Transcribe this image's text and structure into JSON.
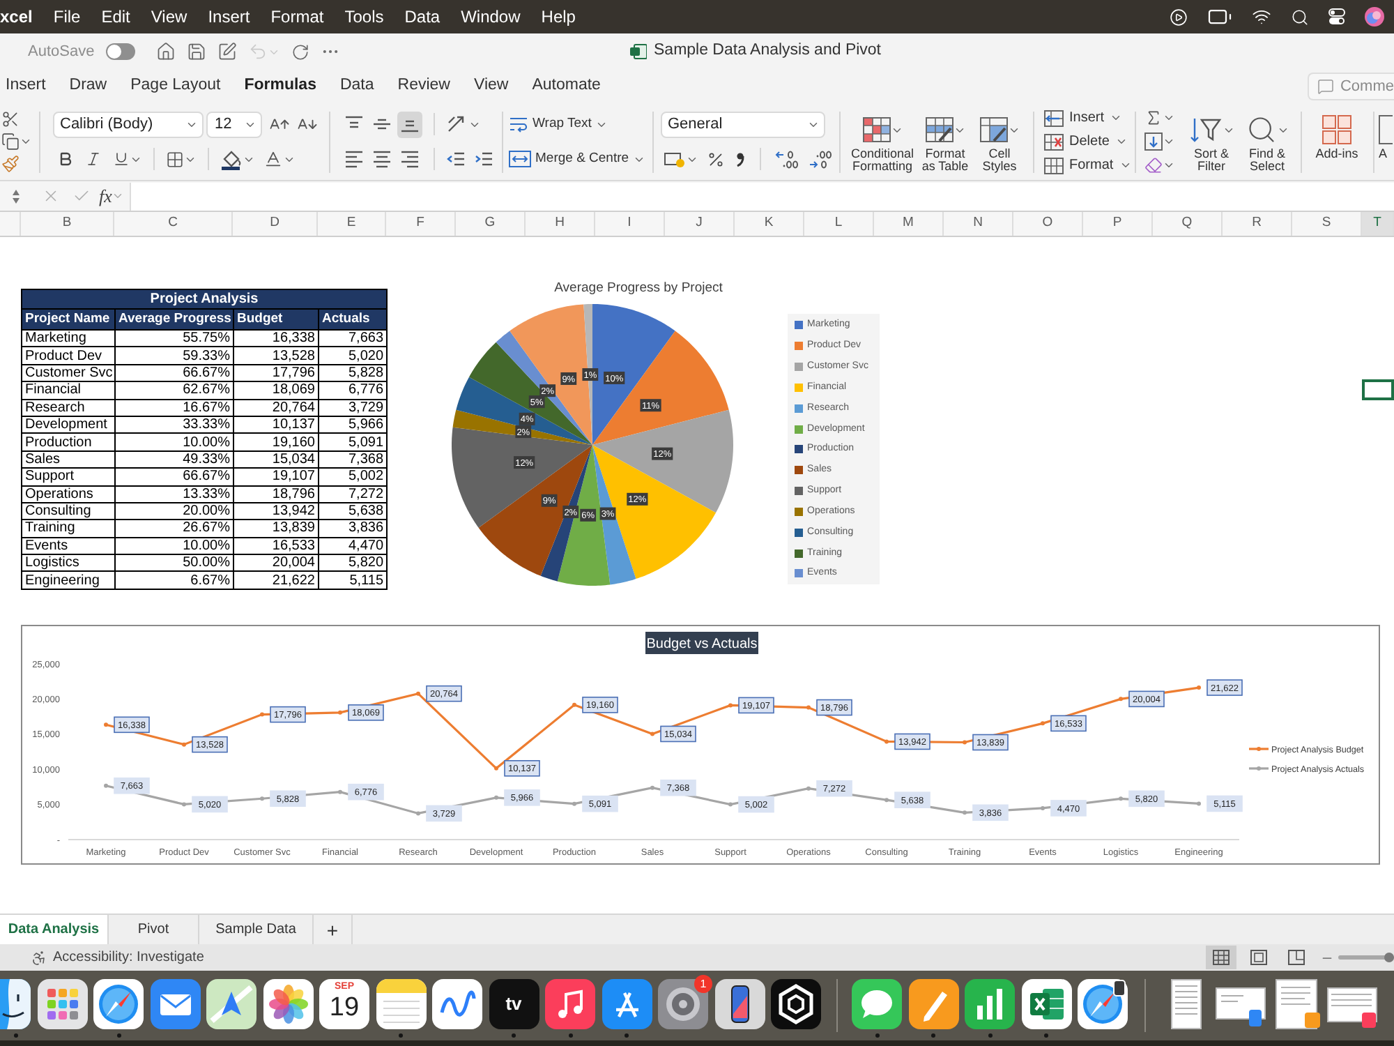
{
  "menu_bar": {
    "app": "xcel",
    "items": [
      "File",
      "Edit",
      "View",
      "Insert",
      "Format",
      "Tools",
      "Data",
      "Window",
      "Help"
    ]
  },
  "title_bar": {
    "autosave": {
      "label": "AutoSave",
      "on": false,
      "disabled": true
    },
    "undo": {
      "disabled": true
    },
    "title": "Sample Data Analysis and Pivot"
  },
  "ribbon": {
    "tabs": [
      {
        "label": "Insert",
        "selected": false
      },
      {
        "label": "Draw",
        "selected": false
      },
      {
        "label": "Page Layout",
        "selected": false
      },
      {
        "label": "Formulas",
        "selected": true
      },
      {
        "label": "Data",
        "selected": false
      },
      {
        "label": "Review",
        "selected": false
      },
      {
        "label": "View",
        "selected": false
      },
      {
        "label": "Automate",
        "selected": false
      }
    ],
    "comments": "Comme",
    "font_name": "Calibri (Body)",
    "font_size": "12",
    "vertical_alignment": [
      {
        "kind": "top",
        "selected": false
      },
      {
        "kind": "middle",
        "selected": false
      },
      {
        "kind": "bottom",
        "selected": true
      }
    ],
    "wrap_text": "Wrap Text",
    "merge": "Merge & Centre",
    "number_format": "General",
    "styles": [
      "Conditional\nFormatting",
      "Format\nas Table",
      "Cell\nStyles"
    ],
    "cells": [
      "Insert",
      "Delete",
      "Format"
    ],
    "sort_filter": "Sort &\nFilter",
    "find_select": "Find &\nSelect",
    "add_ins": "Add-ins",
    "cut_off_button": "A"
  },
  "formula_bar": {
    "function_label": "fx"
  },
  "columns": [
    {
      "label": "B",
      "selected": false
    },
    {
      "label": "C",
      "selected": false
    },
    {
      "label": "D",
      "selected": false
    },
    {
      "label": "E",
      "selected": false
    },
    {
      "label": "F",
      "selected": false
    },
    {
      "label": "G",
      "selected": false
    },
    {
      "label": "H",
      "selected": false
    },
    {
      "label": "I",
      "selected": false
    },
    {
      "label": "J",
      "selected": false
    },
    {
      "label": "K",
      "selected": false
    },
    {
      "label": "L",
      "selected": false
    },
    {
      "label": "M",
      "selected": false
    },
    {
      "label": "N",
      "selected": false
    },
    {
      "label": "O",
      "selected": false
    },
    {
      "label": "P",
      "selected": false
    },
    {
      "label": "Q",
      "selected": false
    },
    {
      "label": "R",
      "selected": false
    },
    {
      "label": "S",
      "selected": false
    },
    {
      "label": "T",
      "selected": true
    }
  ],
  "table": {
    "title": "Project Analysis",
    "columns": [
      "Project Name",
      "Average Progress",
      "Budget",
      "Actuals"
    ],
    "rows": [
      [
        "Marketing",
        "55.75%",
        "16,338",
        "7,663"
      ],
      [
        "Product Dev",
        "59.33%",
        "13,528",
        "5,020"
      ],
      [
        "Customer Svc",
        "66.67%",
        "17,796",
        "5,828"
      ],
      [
        "Financial",
        "62.67%",
        "18,069",
        "6,776"
      ],
      [
        "Research",
        "16.67%",
        "20,764",
        "3,729"
      ],
      [
        "Development",
        "33.33%",
        "10,137",
        "5,966"
      ],
      [
        "Production",
        "10.00%",
        "19,160",
        "5,091"
      ],
      [
        "Sales",
        "49.33%",
        "15,034",
        "7,368"
      ],
      [
        "Support",
        "66.67%",
        "19,107",
        "5,002"
      ],
      [
        "Operations",
        "13.33%",
        "18,796",
        "7,272"
      ],
      [
        "Consulting",
        "20.00%",
        "13,942",
        "5,638"
      ],
      [
        "Training",
        "26.67%",
        "13,839",
        "3,836"
      ],
      [
        "Events",
        "10.00%",
        "16,533",
        "4,470"
      ],
      [
        "Logistics",
        "50.00%",
        "20,004",
        "5,820"
      ],
      [
        "Engineering",
        "6.67%",
        "21,622",
        "5,115"
      ]
    ]
  },
  "pie_chart": {
    "chart_data": [
      {
        "type": "pie",
        "title": "Average Progress by Project",
        "categories": [
          "Marketing",
          "Product Dev",
          "Customer Svc",
          "Financial",
          "Research",
          "Development",
          "Production",
          "Sales",
          "Support",
          "Operations",
          "Consulting",
          "Training",
          "Events",
          null,
          null
        ],
        "values": [
          10,
          11,
          12,
          12,
          3,
          6,
          2,
          9,
          12,
          2,
          4,
          5,
          2,
          9,
          1
        ],
        "colors": [
          "#4472c4",
          "#ed7d31",
          "#a5a5a5",
          "#ffc000",
          "#5b9bd5",
          "#70ad47",
          "#264478",
          "#9e480e",
          "#636363",
          "#997300",
          "#255e91",
          "#43682b",
          "#698ed0",
          "#f1975a",
          "#b7b7b7"
        ],
        "data_labels": true,
        "value_labels": [
          "10%",
          "11%",
          "12%",
          "12%",
          "3%",
          "6%",
          "2%",
          "9%",
          "12%",
          "2%",
          "4%",
          "5%",
          "2%",
          "9%",
          "1%"
        ],
        "legend": "right"
      }
    ]
  },
  "line_chart": {
    "chart_data": [
      {
        "type": "line",
        "title": "Budget vs Actuals",
        "categories": [
          "Marketing",
          "Product Dev",
          "Customer Svc",
          "Financial",
          "Research",
          "Development",
          "Production",
          "Sales",
          "Support",
          "Operations",
          "Consulting",
          "Training",
          "Events",
          "Logistics",
          "Engineering"
        ],
        "series": [
          {
            "name": "Project Analysis Budget",
            "color": "#ed7d31",
            "values": [
              16338,
              13528,
              17796,
              18069,
              20764,
              10137,
              19160,
              15034,
              19107,
              18796,
              13942,
              13839,
              16533,
              20004,
              21622
            ],
            "value_labels": [
              "16,338",
              "13,528",
              "17,796",
              "18,069",
              "20,764",
              "10,137",
              "19,160",
              "15,034",
              "19,107",
              "18,796",
              "13,942",
              "13,839",
              "16,533",
              "20,004",
              "21,622"
            ]
          },
          {
            "name": "Project Analysis Actuals",
            "color": "#a5a5a5",
            "values": [
              7663,
              5020,
              5828,
              6776,
              3729,
              5966,
              5091,
              7368,
              5002,
              7272,
              5638,
              3836,
              4470,
              5820,
              5115
            ],
            "value_labels": [
              "7,663",
              "5,020",
              "5,828",
              "6,776",
              "3,729",
              "5,966",
              "5,091",
              "7,368",
              "5,002",
              "7,272",
              "5,638",
              "3,836",
              "4,470",
              "5,820",
              "5,115"
            ]
          }
        ],
        "ylim": [
          0,
          25000
        ],
        "yticks": [
          {
            "value": 0,
            "label": "-"
          },
          {
            "value": 5000,
            "label": "5,000"
          },
          {
            "value": 10000,
            "label": "10,000"
          },
          {
            "value": 15000,
            "label": "15,000"
          },
          {
            "value": 20000,
            "label": "20,000"
          },
          {
            "value": 25000,
            "label": "25,000"
          }
        ],
        "data_labels": true,
        "legend": "right",
        "marker": "circle"
      }
    ]
  },
  "sheet_tabs": {
    "tabs": [
      {
        "label": "Data Analysis",
        "selected": true
      },
      {
        "label": "Pivot",
        "selected": false
      },
      {
        "label": "Sample Data",
        "selected": false
      }
    ],
    "add": "+"
  },
  "status_bar": {
    "accessibility": "Accessibility: Investigate",
    "views": [
      {
        "kind": "normal",
        "selected": true
      },
      {
        "kind": "page_layout",
        "selected": false
      },
      {
        "kind": "page_break",
        "selected": false
      }
    ],
    "zoom_slider": {
      "level": 1
    }
  },
  "dock": {
    "apps": [
      {
        "kind": "finder",
        "running": true
      },
      {
        "kind": "launchpad",
        "running": false
      },
      {
        "kind": "safari",
        "running": true
      },
      {
        "kind": "mail",
        "running": false
      },
      {
        "kind": "maps",
        "running": false
      },
      {
        "kind": "photos",
        "running": false
      },
      {
        "kind": "calendar",
        "month": "SEP",
        "day": "19",
        "running": false
      },
      {
        "kind": "notes",
        "running": true
      },
      {
        "kind": "freeform",
        "running": false
      },
      {
        "kind": "tv",
        "label": "tv",
        "running": true
      },
      {
        "kind": "music",
        "running": true
      },
      {
        "kind": "appstore",
        "running": true
      },
      {
        "kind": "settings",
        "badge": "1",
        "running": false
      },
      {
        "kind": "mirroring",
        "running": false
      },
      {
        "kind": "hexagon",
        "running": false
      }
    ],
    "recent": [
      {
        "kind": "messages",
        "running": true
      },
      {
        "kind": "pages",
        "running": true
      },
      {
        "kind": "numbers",
        "running": true
      },
      {
        "kind": "excel",
        "running": true
      },
      {
        "kind": "safari_phone",
        "running": false
      }
    ]
  }
}
